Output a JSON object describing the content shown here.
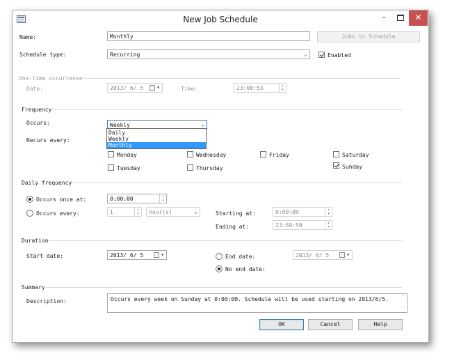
{
  "window": {
    "title": "New Job Schedule"
  },
  "form": {
    "name_label": "Name:",
    "name_value": "Monthly",
    "jobs_in_schedule": "Jobs in Schedule",
    "schedule_type_label": "Schedule type:",
    "schedule_type_value": "Recurring",
    "enabled_label": "Enabled",
    "enabled_checked": true
  },
  "one_time": {
    "header": "One-time occurrence",
    "date_label": "Date:",
    "date_value": "2013/ 6/ 5",
    "time_label": "Time:",
    "time_value": "23:00:53"
  },
  "frequency": {
    "header": "Frequency",
    "occurs_label": "Occurs:",
    "occurs_value": "Weekly",
    "options": [
      "Daily",
      "Weekly",
      "Monthly"
    ],
    "selected_option": "Monthly",
    "recurs_label": "Recurs every:",
    "days": {
      "monday": {
        "label": "Monday",
        "checked": false
      },
      "tuesday": {
        "label": "Tuesday",
        "checked": false
      },
      "wednesday": {
        "label": "Wednesday",
        "checked": false
      },
      "thursday": {
        "label": "Thursday",
        "checked": false
      },
      "friday": {
        "label": "Friday",
        "checked": false
      },
      "saturday": {
        "label": "Saturday",
        "checked": false
      },
      "sunday": {
        "label": "Sunday",
        "checked": true
      }
    }
  },
  "daily": {
    "header": "Daily frequency",
    "once_label": "Occurs once at:",
    "once_value": "0:00:00",
    "every_label": "Occurs every:",
    "every_value": "1",
    "every_unit": "hour(s)",
    "starting_label": "Starting at:",
    "starting_value": "0:00:00",
    "ending_label": "Ending at:",
    "ending_value": "23:59:59"
  },
  "duration": {
    "header": "Duration",
    "start_label": "Start date:",
    "start_value": "2013/ 6/ 5",
    "end_label": "End date:",
    "end_value": "2013/ 6/ 5",
    "no_end_label": "No end date:"
  },
  "summary": {
    "header": "Summary",
    "description_label": "Description:",
    "description_text": "Occurs every week on Sunday at 0:00:00. Schedule will be used starting on 2013/6/5."
  },
  "buttons": {
    "ok": "OK",
    "cancel": "Cancel",
    "help": "Help"
  },
  "colors": {
    "selection": "#3399ff",
    "close_button": "#c75050",
    "default_button_border": "#3c7fb1"
  }
}
